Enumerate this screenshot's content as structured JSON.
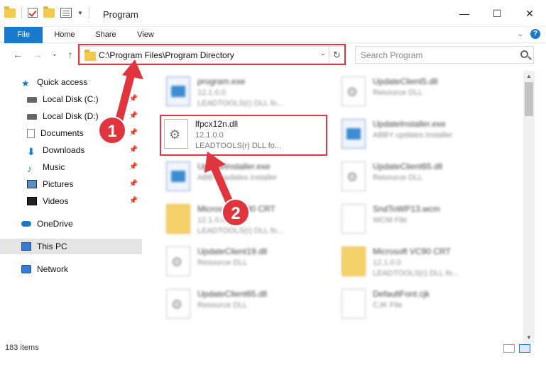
{
  "window": {
    "title": "Program",
    "minimize": "—",
    "maximize": "☐",
    "close": "✕"
  },
  "ribbon": {
    "tabs": [
      {
        "label": "File"
      },
      {
        "label": "Home"
      },
      {
        "label": "Share"
      },
      {
        "label": "View"
      }
    ],
    "help": "?"
  },
  "nav": {
    "back": "←",
    "forward": "→",
    "recent": "⌄",
    "up": "↑"
  },
  "address": {
    "path": "C:\\Program Files\\Program Directory",
    "dropdown": "⌄",
    "refresh": "↻"
  },
  "search": {
    "placeholder": "Search Program"
  },
  "sidebar": {
    "items": [
      {
        "label": "Quick access"
      },
      {
        "label": "Local Disk (C:)"
      },
      {
        "label": "Local Disk (D:)"
      },
      {
        "label": "Documents"
      },
      {
        "label": "Downloads"
      },
      {
        "label": "Music"
      },
      {
        "label": "Pictures"
      },
      {
        "label": "Videos"
      },
      {
        "label": "OneDrive"
      },
      {
        "label": "This PC"
      },
      {
        "label": "Network"
      }
    ],
    "pin": "📌"
  },
  "files": [
    {
      "name": "program.exe",
      "line1": "12.1.0.0",
      "line2": "LEADTOOLS(r) DLL fo..."
    },
    {
      "name": "UpdateClient5.dll",
      "line1": "Resource DLL",
      "line2": ""
    },
    {
      "name": "lfpcx12n.dll",
      "line1": "12.1.0.0",
      "line2": "LEADTOOLS(r) DLL fo..."
    },
    {
      "name": "UpdateInstaller.exe",
      "line1": "ABBY updates installer",
      "line2": ""
    },
    {
      "name": "UpdateInstaller.exe",
      "line1": "ABBY updates installer",
      "line2": ""
    },
    {
      "name": "UpdateClient65.dll",
      "line1": "Resource DLL",
      "line2": ""
    },
    {
      "name": "Microsoft VC90 CRT",
      "line1": "12.1.0.0",
      "line2": "LEADTOOLS(r) DLL fo..."
    },
    {
      "name": "SndToWP13.wcm",
      "line1": "WCM File",
      "line2": ""
    },
    {
      "name": "UpdateClient19.dll",
      "line1": "Resource DLL",
      "line2": ""
    },
    {
      "name": "Microsoft VC90 CRT",
      "line1": "12.1.0.0",
      "line2": "LEADTOOLS(r) DLL fo..."
    },
    {
      "name": "UpdateClient65.dll",
      "line1": "Resource DLL",
      "line2": ""
    },
    {
      "name": "DefaultFont.cjk",
      "line1": "CJK File",
      "line2": ""
    }
  ],
  "status": {
    "items": "183 items"
  },
  "annotations": {
    "step1": "1",
    "step2": "2",
    "color": "#e0343f"
  }
}
